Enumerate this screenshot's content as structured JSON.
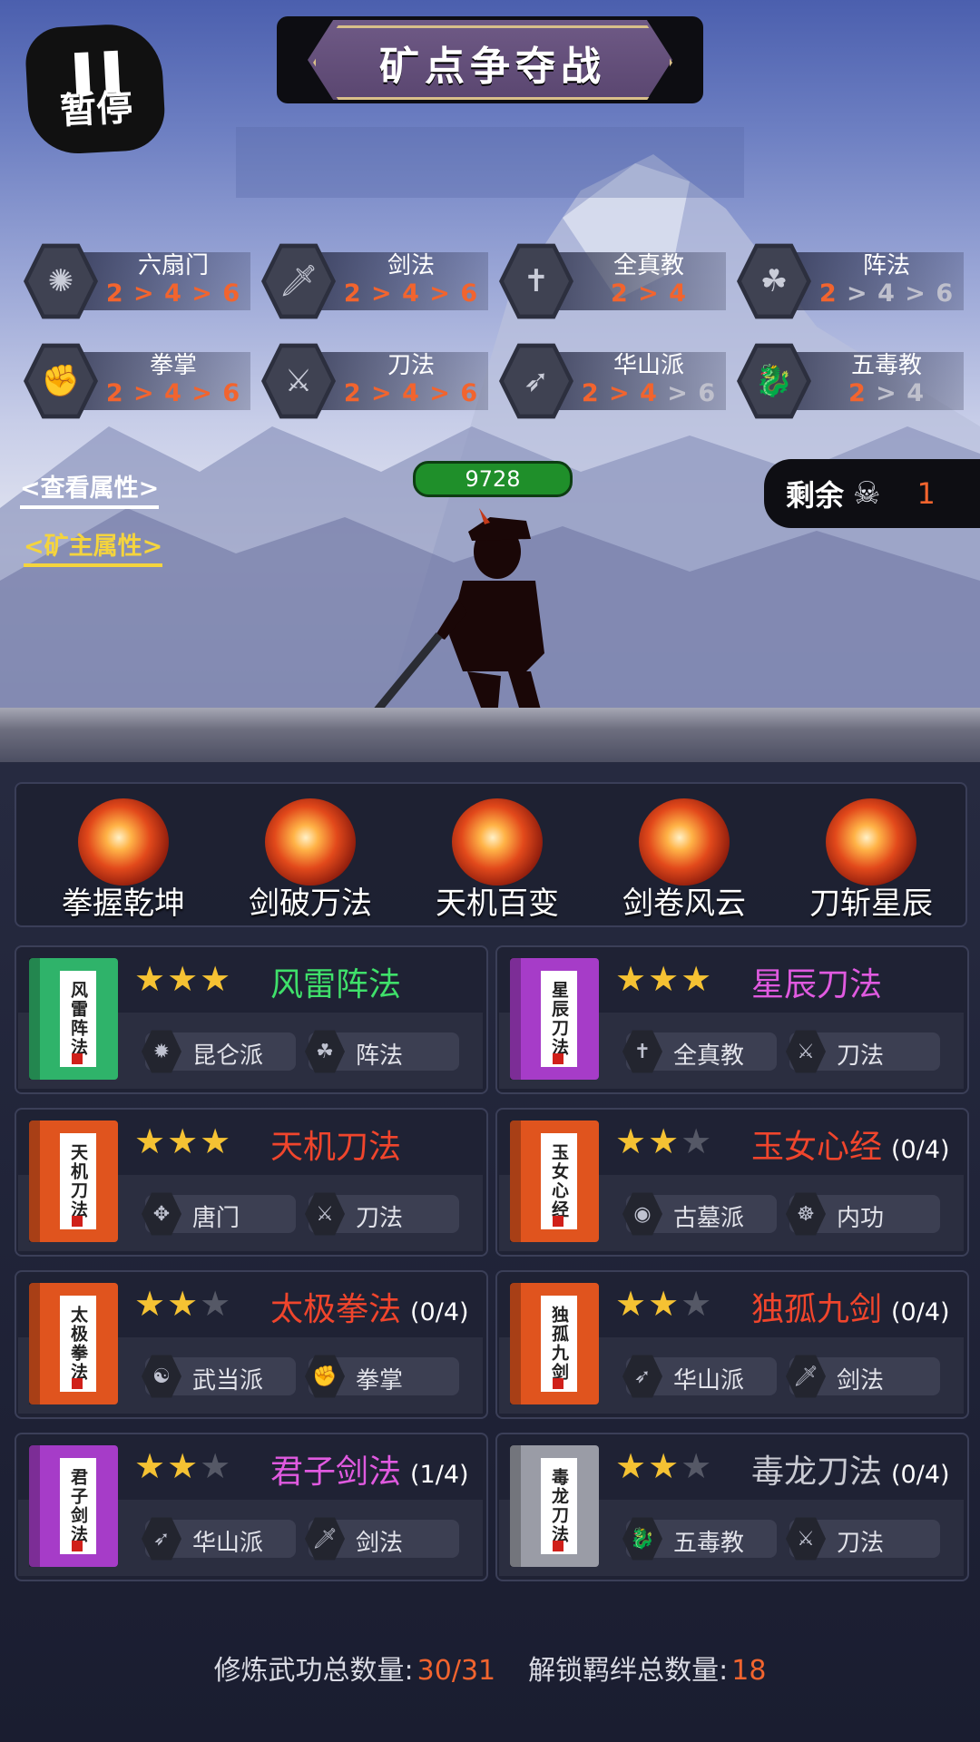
{
  "header": {
    "pause_label": "暂停",
    "title": "矿点争夺战"
  },
  "bonds": [
    {
      "name": "六扇门",
      "tiers": [
        "2",
        "4",
        "6"
      ],
      "active": 3,
      "icon": "sun-emblem-icon"
    },
    {
      "name": "剑法",
      "tiers": [
        "2",
        "4",
        "6"
      ],
      "active": 3,
      "icon": "sword-icon"
    },
    {
      "name": "全真教",
      "tiers": [
        "2",
        "4"
      ],
      "active": 2,
      "icon": "dagger-emblem-icon"
    },
    {
      "name": "阵法",
      "tiers": [
        "2",
        "4",
        "6"
      ],
      "active": 1,
      "icon": "triquetra-icon"
    },
    {
      "name": "拳掌",
      "tiers": [
        "2",
        "4",
        "6"
      ],
      "active": 3,
      "icon": "fist-icon"
    },
    {
      "name": "刀法",
      "tiers": [
        "2",
        "4",
        "6"
      ],
      "active": 3,
      "icon": "crossed-blades-icon"
    },
    {
      "name": "华山派",
      "tiers": [
        "2",
        "4",
        "6"
      ],
      "active": 2,
      "icon": "fish-emblem-icon"
    },
    {
      "name": "五毒教",
      "tiers": [
        "2",
        "4"
      ],
      "active": 1,
      "icon": "dragon-icon"
    }
  ],
  "links": {
    "view_attributes": "<查看属性>",
    "owner_attributes": "<矿主属性>"
  },
  "hero": {
    "hp": "9728"
  },
  "remaining": {
    "label": "剩余",
    "icon": "skull-icon",
    "count": "1"
  },
  "skills": [
    {
      "label": "拳握乾坤"
    },
    {
      "label": "剑破万法"
    },
    {
      "label": "天机百变"
    },
    {
      "label": "剑卷风云"
    },
    {
      "label": "刀斩星辰"
    }
  ],
  "cards": [
    {
      "book_text": "风雷阵法",
      "book_color": "#2fb36a",
      "stars": 3,
      "title": "风雷阵法",
      "title_color": "#3fe06a",
      "progress": "",
      "tags": [
        {
          "label": "昆仑派",
          "icon": "flame-emblem-icon"
        },
        {
          "label": "阵法",
          "icon": "triquetra-icon"
        }
      ]
    },
    {
      "book_text": "星辰刀法",
      "book_color": "#a63cc8",
      "stars": 3,
      "title": "星辰刀法",
      "title_color": "#e05ae0",
      "progress": "",
      "tags": [
        {
          "label": "全真教",
          "icon": "dagger-emblem-icon"
        },
        {
          "label": "刀法",
          "icon": "crossed-blades-icon"
        }
      ]
    },
    {
      "book_text": "天机刀法",
      "book_color": "#e0541e",
      "stars": 3,
      "title": "天机刀法",
      "title_color": "#f0452c",
      "progress": "",
      "tags": [
        {
          "label": "唐门",
          "icon": "shuriken-icon"
        },
        {
          "label": "刀法",
          "icon": "crossed-blades-icon"
        }
      ]
    },
    {
      "book_text": "玉女心经",
      "book_color": "#e0541e",
      "stars": 2,
      "title": "玉女心经",
      "title_color": "#f0452c",
      "progress": "(0/4)",
      "tags": [
        {
          "label": "古墓派",
          "icon": "eye-icon"
        },
        {
          "label": "内功",
          "icon": "meditation-icon"
        }
      ]
    },
    {
      "book_text": "太极拳法",
      "book_color": "#e0541e",
      "stars": 2,
      "title": "太极拳法",
      "title_color": "#f0452c",
      "progress": "(0/4)",
      "tags": [
        {
          "label": "武当派",
          "icon": "yin-yang-icon"
        },
        {
          "label": "拳掌",
          "icon": "fist-icon"
        }
      ]
    },
    {
      "book_text": "独孤九剑",
      "book_color": "#e0541e",
      "stars": 2,
      "title": "独孤九剑",
      "title_color": "#f0452c",
      "progress": "(0/4)",
      "tags": [
        {
          "label": "华山派",
          "icon": "fish-emblem-icon"
        },
        {
          "label": "剑法",
          "icon": "sword-icon"
        }
      ]
    },
    {
      "book_text": "君子剑法",
      "book_color": "#a63cc8",
      "stars": 2,
      "title": "君子剑法",
      "title_color": "#e05ae0",
      "progress": "(1/4)",
      "tags": [
        {
          "label": "华山派",
          "icon": "fish-emblem-icon"
        },
        {
          "label": "剑法",
          "icon": "sword-icon"
        }
      ]
    },
    {
      "book_text": "毒龙刀法",
      "book_color": "#9a9ca6",
      "stars": 2,
      "title": "毒龙刀法",
      "title_color": "#c9cad2",
      "progress": "(0/4)",
      "tags": [
        {
          "label": "五毒教",
          "icon": "dragon-icon"
        },
        {
          "label": "刀法",
          "icon": "crossed-blades-icon"
        }
      ]
    }
  ],
  "footer": {
    "practice_label": "修炼武功总数量:",
    "practice_value": "30/31",
    "bond_label": "解锁羁绊总数量:",
    "bond_value": "18"
  },
  "colors": {
    "accent_orange": "#f2642e",
    "star": "#f5c233",
    "link_yellow": "#f4d43e",
    "hp_green": "#1f8f2a"
  }
}
